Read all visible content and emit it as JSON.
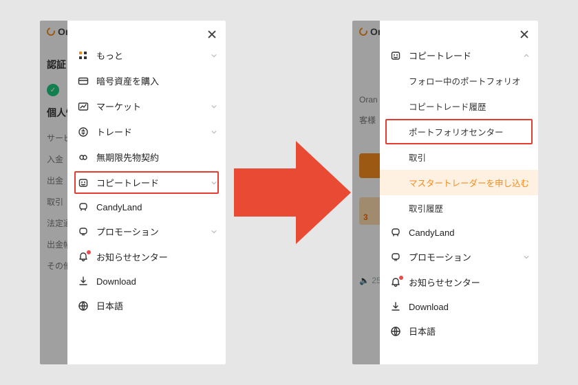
{
  "colors": {
    "accent": "#f28c1f",
    "danger": "#e84a33",
    "frame": "#e53c2f"
  },
  "brand_fragment": "Ora",
  "left_bg": {
    "header1": "認証",
    "header2": "個人情",
    "rows": [
      "サービ",
      "入金",
      "出金",
      "取引",
      "法定通",
      "出金帳",
      "その他"
    ]
  },
  "right_bg": {
    "line1": "Oran",
    "line2": "客様",
    "big_number": "3",
    "footer": "25"
  },
  "left_menu": {
    "items": [
      {
        "icon": "grid",
        "label": "もっと",
        "expand": true
      },
      {
        "icon": "card",
        "label": "暗号資産を購入",
        "expand": false
      },
      {
        "icon": "market",
        "label": "マーケット",
        "expand": true
      },
      {
        "icon": "trade",
        "label": "トレード",
        "expand": true
      },
      {
        "icon": "infinity",
        "label": "無期限先物契約",
        "expand": false
      },
      {
        "icon": "copy",
        "label": "コピートレード",
        "expand": true,
        "framed": true
      },
      {
        "icon": "candy",
        "label": "CandyLand",
        "expand": false
      },
      {
        "icon": "promo",
        "label": "プロモーション",
        "expand": true
      },
      {
        "icon": "bell",
        "label": "お知らせセンター",
        "expand": false,
        "badge": true
      },
      {
        "icon": "download",
        "label": "Download",
        "expand": false
      },
      {
        "icon": "globe",
        "label": "日本語",
        "expand": false
      }
    ]
  },
  "right_menu": {
    "parent": {
      "icon": "copy",
      "label": "コピートレード",
      "expanded": true
    },
    "sub": [
      {
        "label": "フォロー中のポートフォリオ"
      },
      {
        "label": "コピートレード履歴"
      },
      {
        "label": "ポートフォリオセンター",
        "framed": true
      },
      {
        "label": "取引"
      },
      {
        "label": "マスタートレーダーを申し込む",
        "accent": true
      },
      {
        "label": "取引履歴"
      }
    ],
    "rest": [
      {
        "icon": "candy",
        "label": "CandyLand",
        "expand": false
      },
      {
        "icon": "promo",
        "label": "プロモーション",
        "expand": true
      },
      {
        "icon": "bell",
        "label": "お知らせセンター",
        "expand": false,
        "badge": true
      },
      {
        "icon": "download",
        "label": "Download",
        "expand": false
      },
      {
        "icon": "globe",
        "label": "日本語",
        "expand": false
      }
    ]
  }
}
